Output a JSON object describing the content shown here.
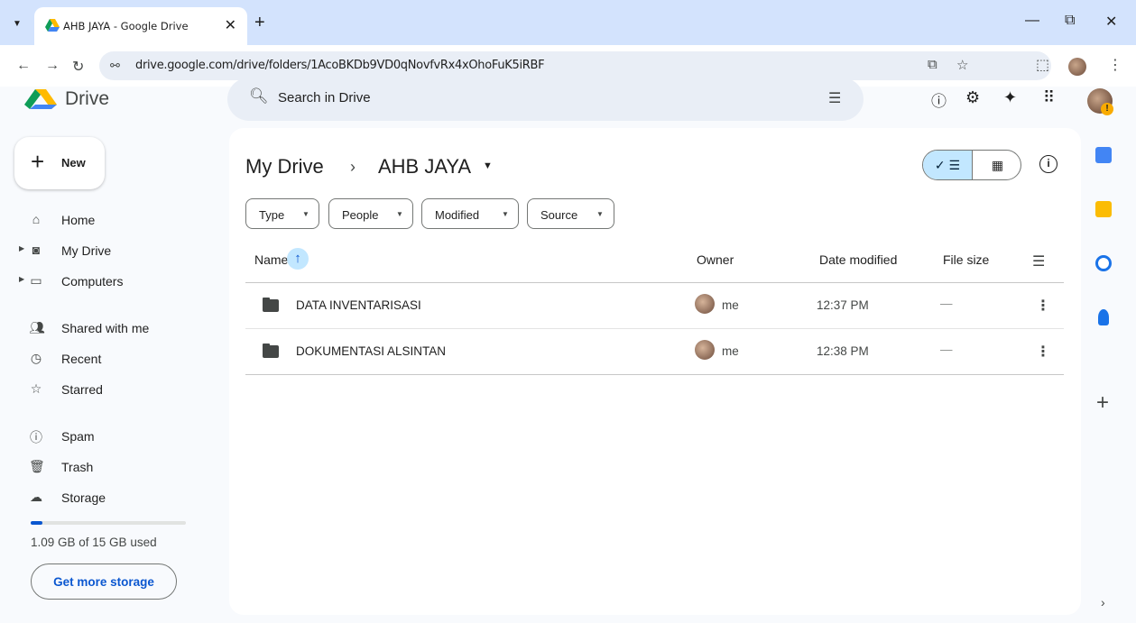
{
  "browser": {
    "tab_title": "AHB JAYA - Google Drive",
    "tab_close": "✕",
    "new_tab": "+",
    "dropdown": "⌄",
    "window_controls": [
      "—",
      "⧉",
      "✕"
    ],
    "url": "drive.google.com/drive/folders/1AcoBKDb9VD0qNovfvRx4xOhoFuK5iRBF",
    "nav_icons": [
      "back-icon",
      "forward-icon",
      "reload-icon",
      "site-info-icon"
    ]
  },
  "drive": {
    "logo_text": "Drive",
    "search_placeholder": "Search in Drive",
    "header_icons": [
      "help-icon",
      "settings-icon",
      "gemini-icon",
      "apps-icon"
    ]
  },
  "sidebar": {
    "new_label": "New",
    "items": [
      {
        "label": "Home",
        "icon": "home-icon"
      },
      {
        "label": "My Drive",
        "icon": "my-drive-icon"
      },
      {
        "label": "Computers",
        "icon": "computers-icon"
      },
      {
        "label": "Shared with me",
        "icon": "shared-icon"
      },
      {
        "label": "Recent",
        "icon": "clock-icon"
      },
      {
        "label": "Starred",
        "icon": "star-icon"
      },
      {
        "label": "Spam",
        "icon": "spam-icon"
      },
      {
        "label": "Trash",
        "icon": "trash-icon"
      },
      {
        "label": "Storage",
        "icon": "cloud-icon"
      }
    ],
    "storage_used_fraction": 0.073,
    "storage_text": "1.09 GB of 15 GB used",
    "get_storage_label": "Get more storage"
  },
  "main": {
    "breadcrumb_root": "My Drive",
    "breadcrumb_sep": "›",
    "breadcrumb_current": "AHB JAYA",
    "filters": [
      "Type",
      "People",
      "Modified",
      "Source"
    ],
    "columns": {
      "name": "Name",
      "owner": "Owner",
      "date": "Date modified",
      "size": "File size"
    },
    "rows": [
      {
        "name": "DATA INVENTARISASI",
        "owner": "me",
        "date": "12:37 PM",
        "size": "—"
      },
      {
        "name": "DOKUMENTASI ALSINTAN",
        "owner": "me",
        "date": "12:38 PM",
        "size": "—"
      }
    ]
  },
  "colors": {
    "accent": "#0b57d0",
    "selected": "#c2e7ff",
    "tabbar": "#d3e3fd"
  }
}
